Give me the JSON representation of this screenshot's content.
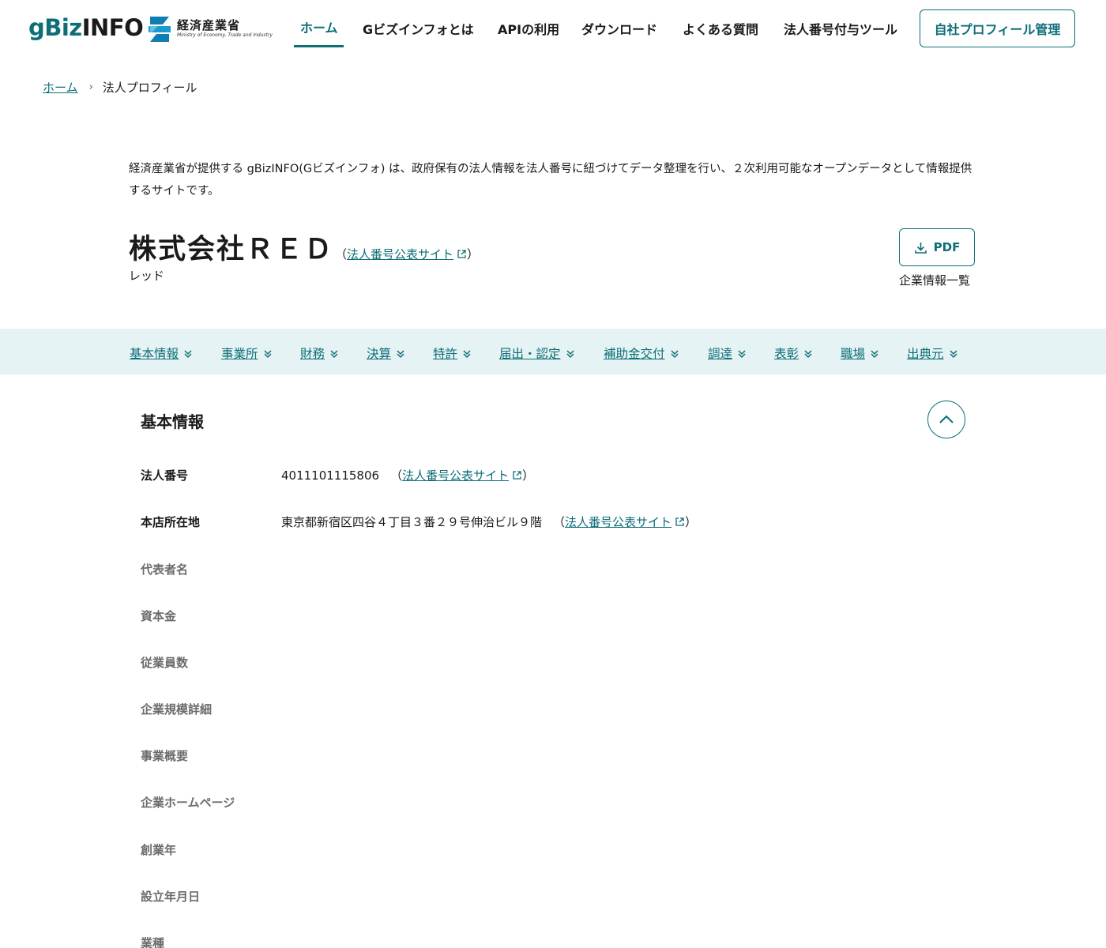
{
  "header": {
    "logo_text_g": "g",
    "logo_text_biz": "Biz",
    "logo_text_info": "INFO",
    "ministry_name": "経済産業省",
    "ministry_name_en": "Ministry of Economy, Trade and Industry",
    "nav": [
      {
        "label": "ホーム",
        "active": true
      },
      {
        "label": "Gビズインフォとは",
        "active": false
      },
      {
        "label": "APIの利用",
        "active": false
      },
      {
        "label": "ダウンロード",
        "active": false
      },
      {
        "label": "よくある質問",
        "active": false
      },
      {
        "label": "法人番号付与ツール",
        "active": false
      }
    ],
    "manage_button": "自社プロフィール管理"
  },
  "breadcrumb": {
    "home": "ホーム",
    "separator": "›",
    "current": "法人プロフィール"
  },
  "intro": "経済産業省が提供する gBizINFO(Gビズインフォ) は、政府保有の法人情報を法人番号に紐づけてデータ整理を行い、２次利用可能なオープンデータとして情報提供するサイトです。",
  "company": {
    "name": "株式会社ＲＥＤ",
    "link_open": "（",
    "link_label": "法人番号公表サイト",
    "link_close": "）",
    "kana": "レッド",
    "pdf_label": "PDF",
    "pdf_caption": "企業情報一覧"
  },
  "section_nav": [
    "基本情報",
    "事業所",
    "財務",
    "決算",
    "特許",
    "届出・認定",
    "補助金交付",
    "調達",
    "表彰",
    "職場",
    "出典元"
  ],
  "basic_info": {
    "title": "基本情報",
    "rows": [
      {
        "label": "法人番号",
        "value": "4011101115806",
        "link_label": "法人番号公表サイト"
      },
      {
        "label": "本店所在地",
        "value": "東京都新宿区四谷４丁目３番２９号伸治ビル９階",
        "link_label": "法人番号公表サイト"
      },
      {
        "label": "代表者名",
        "value": ""
      },
      {
        "label": "資本金",
        "value": ""
      },
      {
        "label": "従業員数",
        "value": ""
      },
      {
        "label": "企業規模詳細",
        "value": ""
      },
      {
        "label": "事業概要",
        "value": ""
      },
      {
        "label": "企業ホームページ",
        "value": ""
      },
      {
        "label": "創業年",
        "value": ""
      },
      {
        "label": "設立年月日",
        "value": ""
      },
      {
        "label": "業種",
        "value": ""
      }
    ],
    "paren_open": "（",
    "paren_close": "）"
  },
  "colors": {
    "accent": "#0d6e78",
    "section_nav_bg": "#e6f3f4",
    "text": "#1a1a1a",
    "muted_label": "#6b6b6b"
  },
  "icons": {
    "pdf": "download-icon",
    "external": "external-link-icon",
    "section_nav": "double-chevron-down-icon",
    "collapse": "chevron-up-icon",
    "breadcrumb_sep": "chevron-right-icon"
  }
}
